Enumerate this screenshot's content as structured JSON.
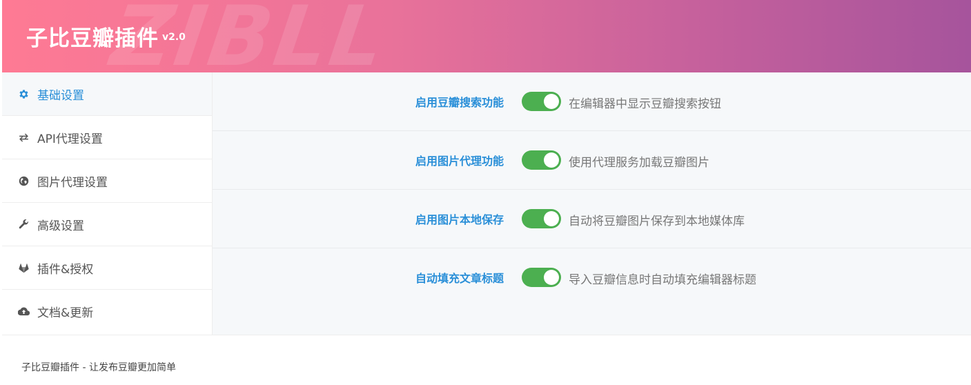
{
  "header": {
    "title": "子比豆瓣插件",
    "version": "v2.0",
    "watermark": "ZIBLL"
  },
  "sidebar": {
    "items": [
      {
        "label": "基础设置",
        "icon": "gear-icon",
        "active": true
      },
      {
        "label": "API代理设置",
        "icon": "exchange-icon",
        "active": false
      },
      {
        "label": "图片代理设置",
        "icon": "globe-icon",
        "active": false
      },
      {
        "label": "高级设置",
        "icon": "wrench-icon",
        "active": false
      },
      {
        "label": "插件&授权",
        "icon": "gitlab-icon",
        "active": false
      },
      {
        "label": "文档&更新",
        "icon": "cloud-upload-icon",
        "active": false
      }
    ]
  },
  "settings": [
    {
      "label": "启用豆瓣搜索功能",
      "enabled": true,
      "description": "在编辑器中显示豆瓣搜索按钮"
    },
    {
      "label": "启用图片代理功能",
      "enabled": true,
      "description": "使用代理服务加载豆瓣图片"
    },
    {
      "label": "启用图片本地保存",
      "enabled": true,
      "description": "自动将豆瓣图片保存到本地媒体库"
    },
    {
      "label": "自动填充文章标题",
      "enabled": true,
      "description": "导入豆瓣信息时自动填充编辑器标题"
    }
  ],
  "footer": {
    "text": "子比豆瓣插件 - 让发布豆瓣更加简单"
  },
  "colors": {
    "accent": "#2a8fd8",
    "toggle_on": "#4caf50",
    "header_start": "#fe7a94",
    "header_end": "#a6549c"
  }
}
